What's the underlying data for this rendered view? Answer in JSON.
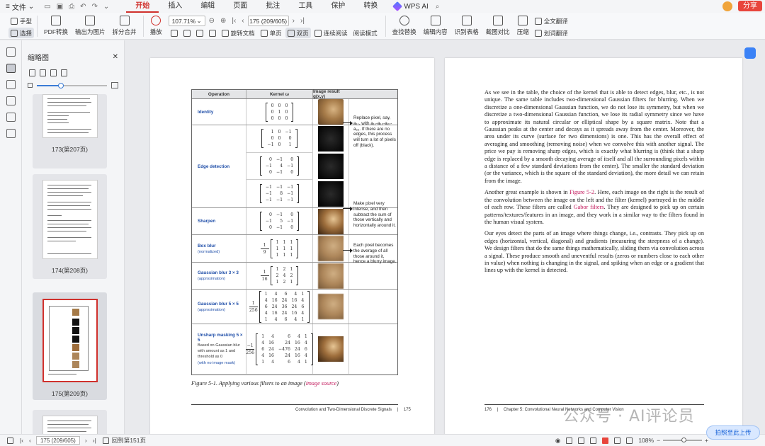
{
  "menubar": {
    "file_label": "文件",
    "tabs": [
      "开始",
      "插入",
      "编辑",
      "页面",
      "批注",
      "工具",
      "保护",
      "转换"
    ],
    "active_tab": "开始",
    "wps_ai": "WPS AI",
    "share": "分享"
  },
  "ribbon": {
    "hand": "手型",
    "select": "选择",
    "pdf_convert": "PDF转换",
    "export_image": "输出为图片",
    "split_merge": "拆分合并",
    "play": "播放",
    "zoom": "107.71%",
    "page_indicator": "175 (209/605)",
    "rotate": "旋转文档",
    "single": "单页",
    "double": "双页",
    "continuous": "连续阅读",
    "read_mode": "阅读模式",
    "find_replace": "查找替换",
    "edit_content": "编辑内容",
    "recognize_table": "识别表格",
    "screenshot_compare": "截图对比",
    "compress": "压缩",
    "full_translate": "全文翻译",
    "word_translate": "划词翻译"
  },
  "thumbnails": {
    "title": "缩略图",
    "pages": [
      {
        "label": "173(第207页)"
      },
      {
        "label": "174(第208页)"
      },
      {
        "label": "175(第209页)"
      }
    ]
  },
  "left_page": {
    "table_headers": [
      "Operation",
      "Kernel ω",
      "Image result g(x,y)"
    ],
    "rows": [
      {
        "name": "Identity",
        "sub": "",
        "desc": "",
        "matrix": [
          [
            "0",
            "0",
            "0"
          ],
          [
            "0",
            "1",
            "0"
          ],
          [
            "0",
            "0",
            "0"
          ]
        ],
        "scale_num": "",
        "scale_den": "",
        "image": "camel"
      },
      {
        "name": "Edge detection",
        "sub": "",
        "desc": "",
        "matrices": [
          [
            [
              "1",
              "0",
              "−1"
            ],
            [
              "0",
              "0",
              "0"
            ],
            [
              "−1",
              "0",
              "1"
            ]
          ],
          [
            [
              "0",
              "−1",
              "0"
            ],
            [
              "−1",
              "4",
              "−1"
            ],
            [
              "0",
              "−1",
              "0"
            ]
          ],
          [
            [
              "−1",
              "−1",
              "−1"
            ],
            [
              "−1",
              "8",
              "−1"
            ],
            [
              "−1",
              "−1",
              "−1"
            ]
          ]
        ],
        "image": "edge"
      },
      {
        "name": "Sharpen",
        "sub": "",
        "desc": "",
        "matrix": [
          [
            "0",
            "−1",
            "0"
          ],
          [
            "−1",
            "5",
            "−1"
          ],
          [
            "0",
            "−1",
            "0"
          ]
        ],
        "image": "sharp"
      },
      {
        "name": "Box blur",
        "sub": "(normalized)",
        "desc": "",
        "matrix": [
          [
            "1",
            "1",
            "1"
          ],
          [
            "1",
            "1",
            "1"
          ],
          [
            "1",
            "1",
            "1"
          ]
        ],
        "scale_num": "1",
        "scale_den": "9",
        "image": "blur"
      },
      {
        "name": "Gaussian blur 3 × 3",
        "sub": "(approximation)",
        "desc": "",
        "matrix": [
          [
            "1",
            "2",
            "1"
          ],
          [
            "2",
            "4",
            "2"
          ],
          [
            "1",
            "2",
            "1"
          ]
        ],
        "scale_num": "1",
        "scale_den": "16",
        "image": "blur"
      },
      {
        "name": "Gaussian blur 5 × 5",
        "sub": "(approximation)",
        "desc": "",
        "matrix": [
          [
            "1",
            "4",
            "6",
            "4",
            "1"
          ],
          [
            "4",
            "16",
            "24",
            "16",
            "4"
          ],
          [
            "6",
            "24",
            "36",
            "24",
            "6"
          ],
          [
            "4",
            "16",
            "24",
            "16",
            "4"
          ],
          [
            "1",
            "4",
            "6",
            "4",
            "1"
          ]
        ],
        "scale_num": "1",
        "scale_den": "256",
        "image": "blur"
      },
      {
        "name": "Unsharp masking 5 × 5",
        "sub": "",
        "desc": "Based on Gaussian blur with amount as 1 and threshold as 0",
        "desc2": "(with no image mask)",
        "matrix": [
          [
            "1",
            "4",
            "6",
            "4",
            "1"
          ],
          [
            "4",
            "16",
            "24",
            "16",
            "4"
          ],
          [
            "6",
            "24",
            "−476",
            "24",
            "6"
          ],
          [
            "4",
            "16",
            "24",
            "16",
            "4"
          ],
          [
            "1",
            "4",
            "6",
            "4",
            "1"
          ]
        ],
        "scale_num": "−1",
        "scale_den": "256",
        "image": "sharp"
      }
    ],
    "callouts": [
      "Replace pixel, say, a₁₁, with a₁₁-a₁₂-a₂₁-a₂₂. If there are no edges, this process will turn a lot of pixels off (black).",
      "Make pixel very intense, and then subtract the sum of those vertically and horizontally around it.",
      "Each pixel becomes the average of all those around it, hence a blurry image."
    ],
    "caption_prefix": "Figure 5-1. Applying various filters to an image (",
    "caption_link": "image source",
    "caption_suffix": ")",
    "footer_text": "Convolution and Two-Dimensional Discrete Signals",
    "page_number": "175"
  },
  "right_page": {
    "para1": "As we see in the table, the choice of the kernel that is able to detect edges, blur, etc., is not unique. The same table includes two-dimensional Gaussian filters for blurring. When we discretize a one-dimensional Gaussian function, we do not lose its symmetry, but when we discretize a two-dimensional Gaussian function, we lose its radial symmetry since we have to approximate its natural circular or elliptical shape by a square matrix. Note that a Gaussian peaks at the center and decays as it spreads away from the center. Moreover, the area under its curve (surface for two dimensions) is one. This has the overall effect of averaging and smoothing (removing noise) when we convolve this with another signal. The price we pay is removing sharp edges, which is exactly what blurring is (think that a sharp edge is replaced by a smooth decaying average of itself and all the surrounding pixels within a distance of a few standard deviations from the center). The smaller the standard deviation (or the variance, which is the square of the standard deviation), the more detail we can retain from the image.",
    "para2_a": "Another great example is shown in ",
    "para2_link1": "Figure 5-2",
    "para2_b": ". Here, each image on the right is the result of the convolution between the image on the left and the filter (kernel) portrayed in the middle of each row. These filters are called ",
    "para2_link2": "Gabor filters",
    "para2_c": ". They are designed to pick up on certain patterns/textures/features in an image, and they work in a similar way to the filters found in the human visual system.",
    "para3": "Our eyes detect the parts of an image where things change, i.e., contrasts. They pick up on edges (horizontal, vertical, diagonal) and gradients (measuring the steepness of a change). We design filters that do the same things mathematically, sliding them via convolution across a signal. These produce smooth and uneventful results (zeros or numbers close to each other in value) when nothing is changing in the signal, and spiking when an edge or a gradient that lines up with the kernel is detected.",
    "page_number": "176",
    "footer_text": "Chapter 5: Convolutional Neural Networks and Computer Vision"
  },
  "statusbar": {
    "page_indicator": "175 (209/605)",
    "back_text": "回到第151页",
    "zoom": "108%"
  },
  "watermark": "公众号 · AI评论员",
  "upload_btn": "拍照至此上传"
}
